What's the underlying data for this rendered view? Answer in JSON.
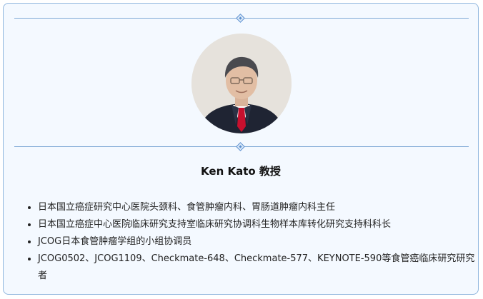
{
  "profile": {
    "name": "Ken Kato 教授",
    "bio": [
      "日本国立癌症研究中心医院头颈科、食管肿瘤内科、胃肠道肿瘤内科主任",
      "日本国立癌症中心医院临床研究支持室临床研究协调科生物样本库转化研究支持科科长",
      "JCOG日本食管肿瘤学组的小组协调员",
      "JCOG0502、JCOG1109、Checkmate-648、Checkmate-577、KEYNOTE-590等食管癌临床研究研究者"
    ]
  },
  "colors": {
    "card_border": "#8fb6de",
    "card_background": "#f4f9ff",
    "divider": "#7fa9d6",
    "tie": "#c8102e"
  }
}
